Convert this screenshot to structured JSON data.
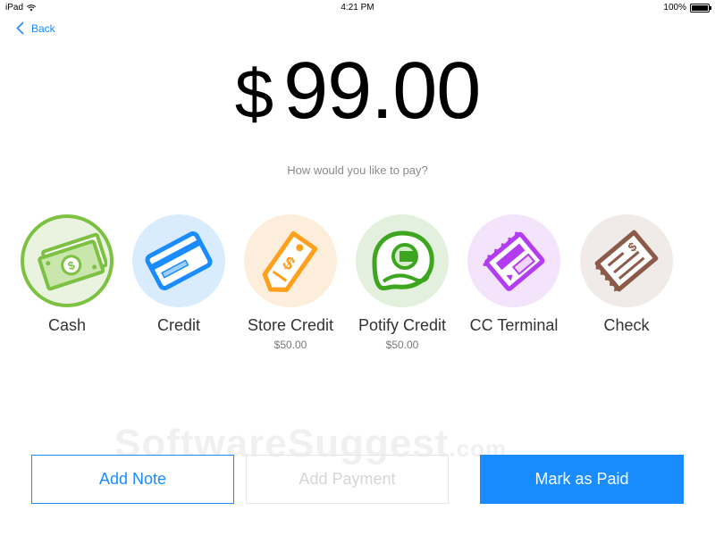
{
  "status_bar": {
    "device": "iPad",
    "time": "4:21 PM",
    "battery": "100%"
  },
  "nav": {
    "back_label": "Back"
  },
  "payment": {
    "currency_symbol": "$",
    "amount": "99.00",
    "question": "How would you like to pay?"
  },
  "methods": [
    {
      "label": "Cash",
      "sub": "",
      "icon": "cash-icon",
      "color": "#7dc142",
      "bg": "#e9f3df",
      "selected": true
    },
    {
      "label": "Credit",
      "sub": "",
      "icon": "credit-card-icon",
      "color": "#1a8cff",
      "bg": "#d9ecfd"
    },
    {
      "label": "Store Credit",
      "sub": "$50.00",
      "icon": "tag-icon",
      "color": "#ff9f1c",
      "bg": "#fdeedb"
    },
    {
      "label": "Potify Credit",
      "sub": "$50.00",
      "icon": "potify-icon",
      "color": "#3da61f",
      "bg": "#e3f0dd"
    },
    {
      "label": "CC Terminal",
      "sub": "",
      "icon": "cc-terminal-icon",
      "color": "#b23cf0",
      "bg": "#f3e3fb"
    },
    {
      "label": "Check",
      "sub": "",
      "icon": "check-icon",
      "color": "#8b5a48",
      "bg": "#f0ebe8"
    }
  ],
  "actions": {
    "add_note": "Add Note",
    "add_payment": "Add Payment",
    "mark_paid": "Mark as Paid"
  },
  "watermark": {
    "text": "SoftwareSuggest",
    "domain": ".com"
  },
  "colors": {
    "accent": "#1a8cff",
    "text": "#222222",
    "muted": "#8a8a8a"
  }
}
